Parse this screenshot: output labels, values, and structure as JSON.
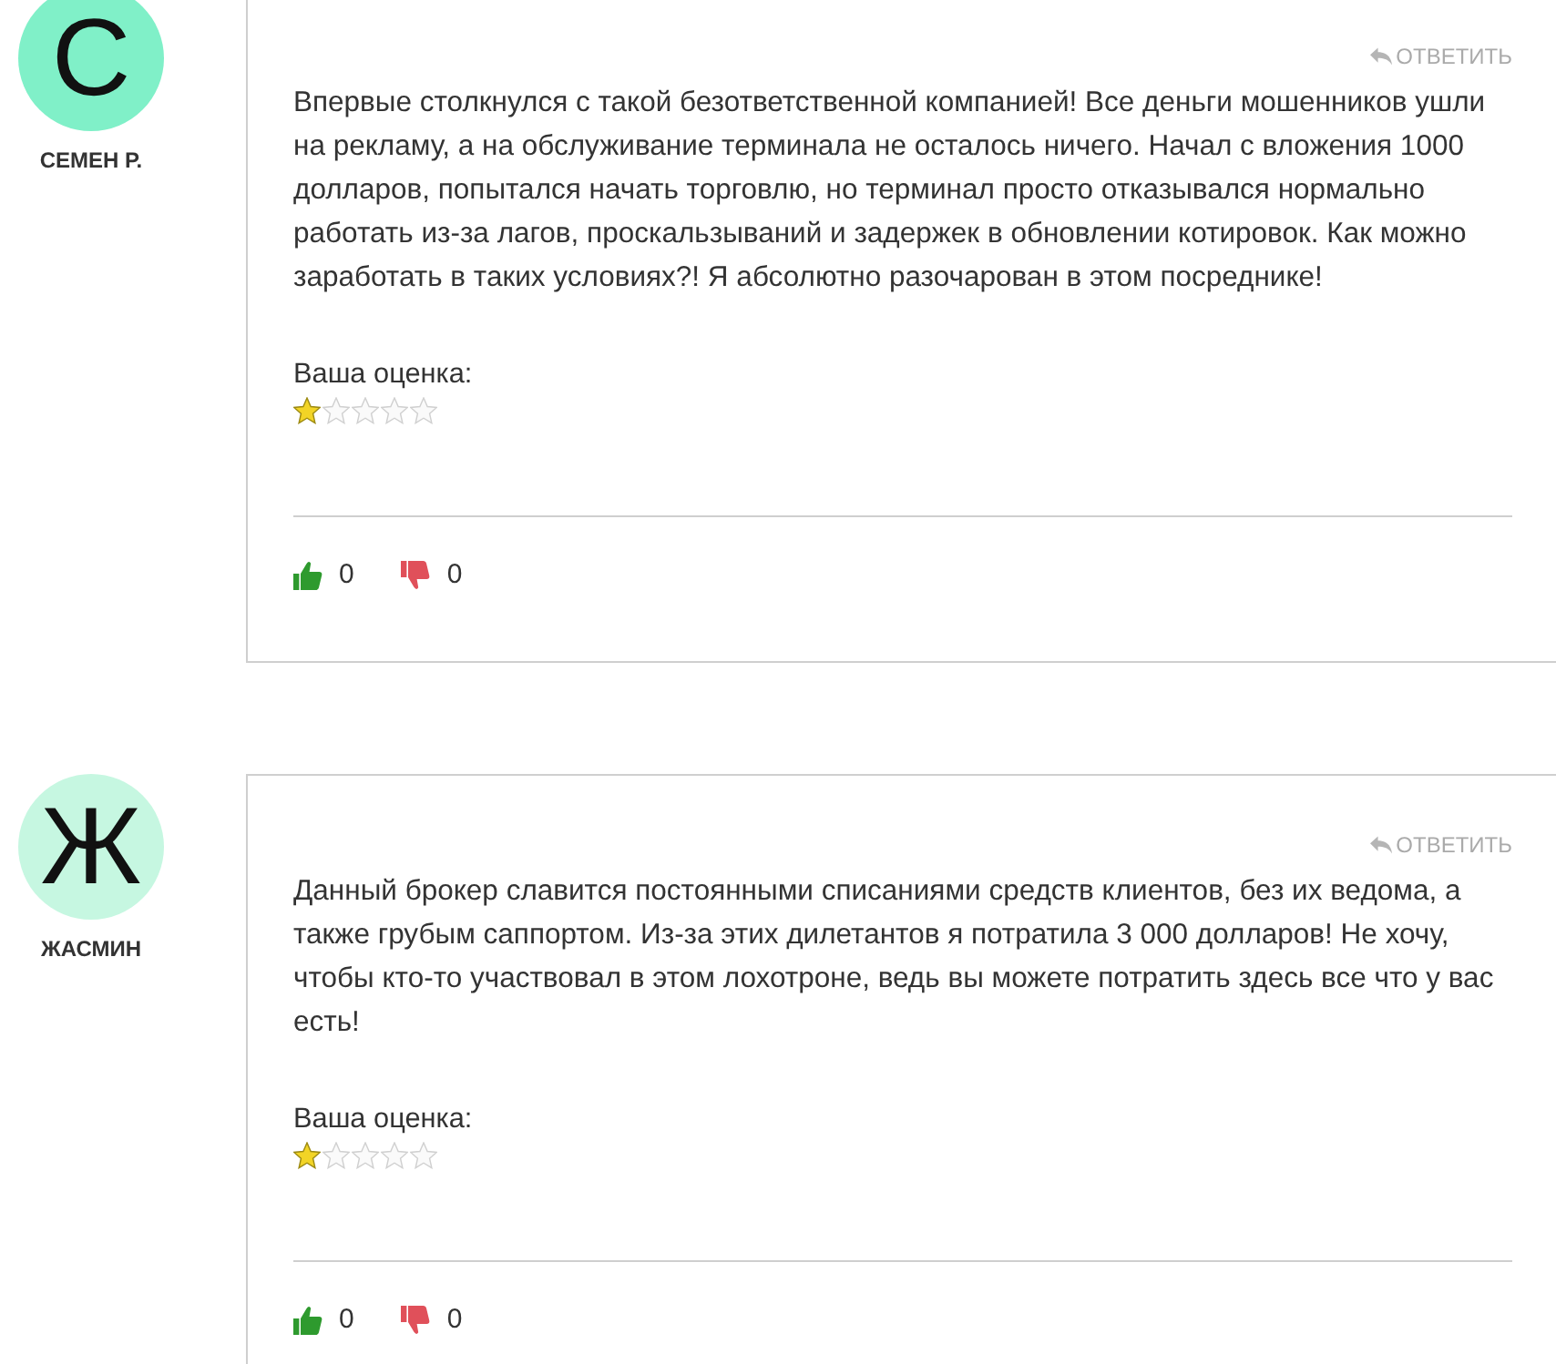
{
  "reviews": [
    {
      "author": "СЕМЕН Р.",
      "initial": "С",
      "color": "#80f0c8",
      "reply": "ОТВЕТИТЬ",
      "text": "Впервые столкнулся с такой безответственной компанией! Все деньги мошенников ушли на рекламу, а на обслуживание терминала не осталось ничего. Начал с вложения 1000 долларов, попытался начать торговлю, но терминал просто отказывался нормально работать из-за лагов, проскальзываний и задержек в обновлении котировок. Как можно заработать в таких условиях?! Я абсолютно разочарован в этом посреднике!",
      "rating_label": "Ваша оценка:",
      "stars": 1,
      "likes": "0",
      "dislikes": "0"
    },
    {
      "author": "ЖАСМИН",
      "initial": "Ж",
      "color": "#c6f7e1",
      "reply": "ОТВЕТИТЬ",
      "text": "Данный брокер славится постоянными списаниями средств клиентов, без их ведома, а также грубым саппортом. Из-за этих дилетантов я потратила 3 000 долларов! Не хочу, чтобы кто-то участвовал в этом лохотроне, ведь вы можете потратить здесь все что у вас есть!",
      "rating_label": "Ваша оценка:",
      "stars": 1,
      "likes": "0",
      "dislikes": "0"
    }
  ]
}
